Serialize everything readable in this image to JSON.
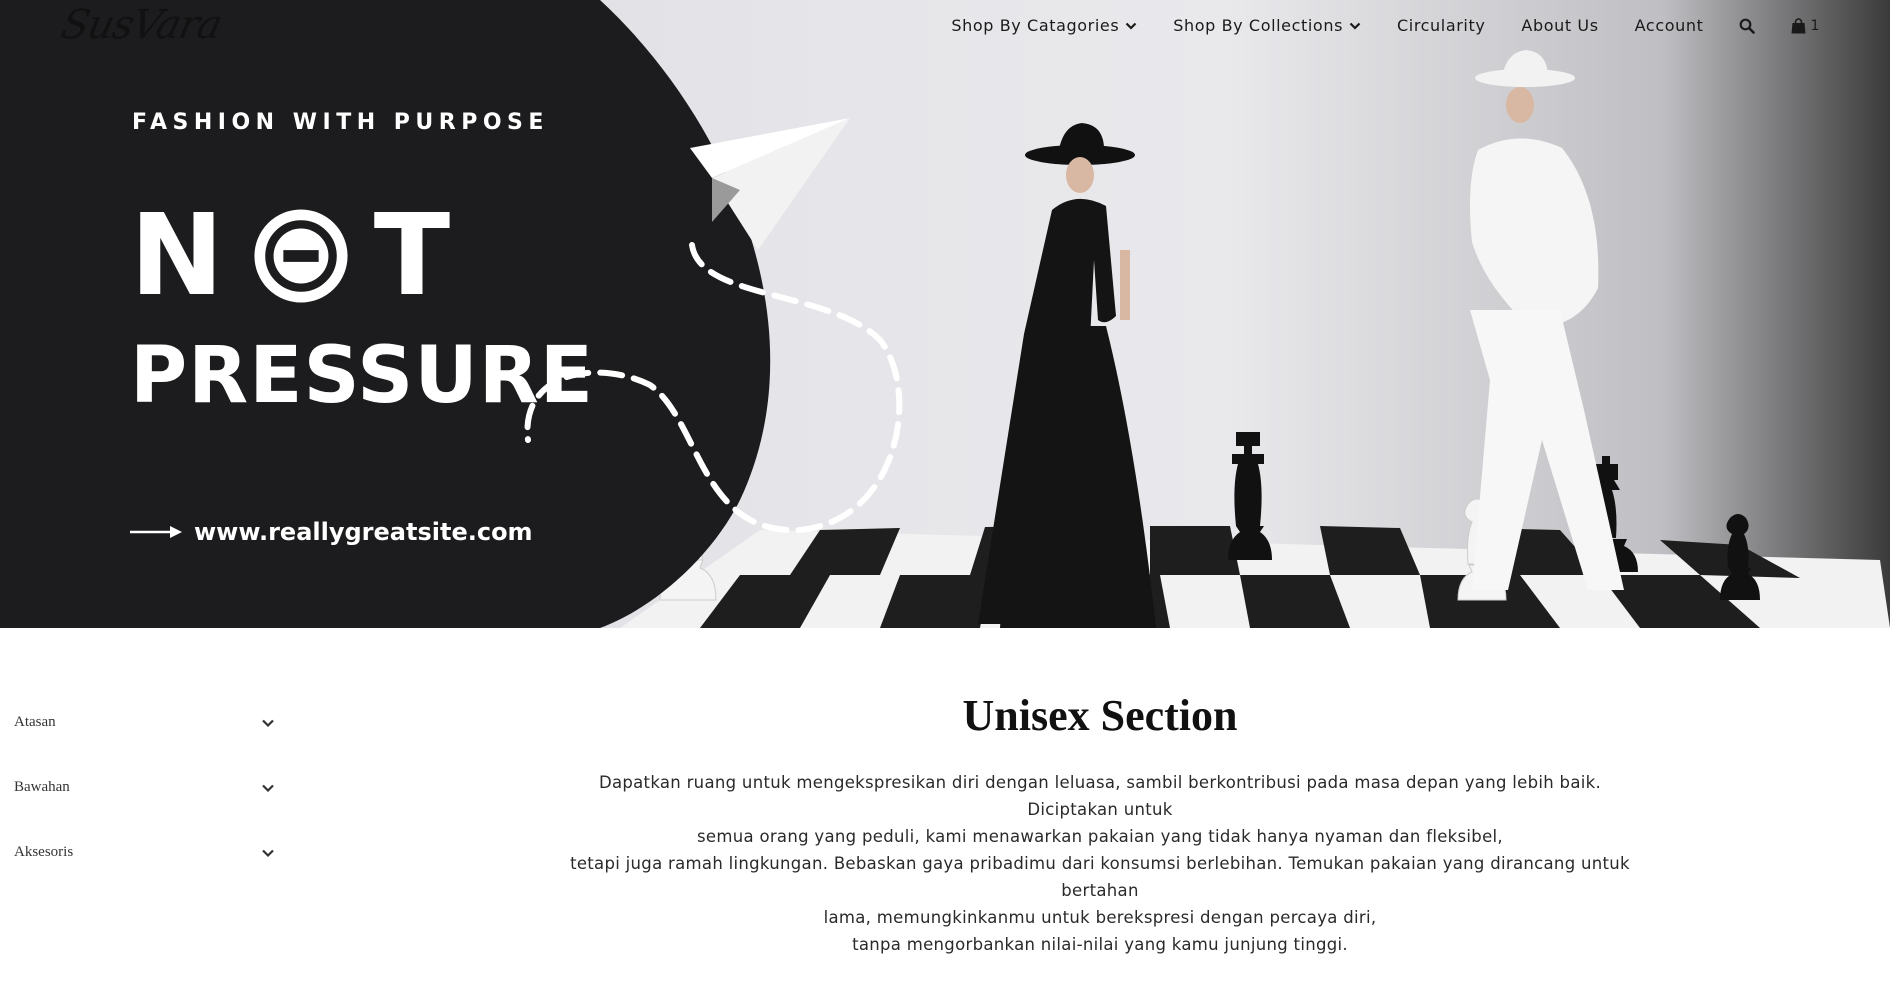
{
  "brand": {
    "logo_text": "SusVara"
  },
  "nav": {
    "items": [
      {
        "label": "Shop By Catagories",
        "has_dropdown": true
      },
      {
        "label": "Shop By Collections",
        "has_dropdown": true
      },
      {
        "label": "Circularity",
        "has_dropdown": false
      },
      {
        "label": "About Us",
        "has_dropdown": false
      },
      {
        "label": "Account",
        "has_dropdown": false
      }
    ],
    "search_icon": "search-icon",
    "cart_icon": "shopping-bag-icon",
    "cart_count": "1"
  },
  "hero": {
    "tagline": "FASHION WITH PURPOSE",
    "headline_word1_start": "N",
    "headline_word1_end": "T",
    "headline_word2": "PRESSURE",
    "website": "www.reallygreatsite.com",
    "colors": {
      "dark_panel": "#1c1c1e",
      "text": "#ffffff"
    }
  },
  "sidebar": {
    "filters": [
      {
        "label": "Atasan"
      },
      {
        "label": "Bawahan"
      },
      {
        "label": "Aksesoris"
      }
    ]
  },
  "main": {
    "title": "Unisex Section",
    "description_lines": [
      "Dapatkan ruang untuk mengekspresikan diri dengan leluasa, sambil berkontribusi pada masa depan yang lebih baik. Diciptakan untuk",
      "semua orang yang peduli, kami menawarkan pakaian yang tidak hanya nyaman dan fleksibel,",
      "tetapi juga ramah lingkungan. Bebaskan gaya pribadimu dari konsumsi berlebihan. Temukan pakaian yang dirancang untuk bertahan",
      "lama, memungkinkanmu untuk berekspresi dengan percaya diri,",
      "tanpa mengorbankan nilai-nilai yang kamu junjung tinggi."
    ]
  }
}
